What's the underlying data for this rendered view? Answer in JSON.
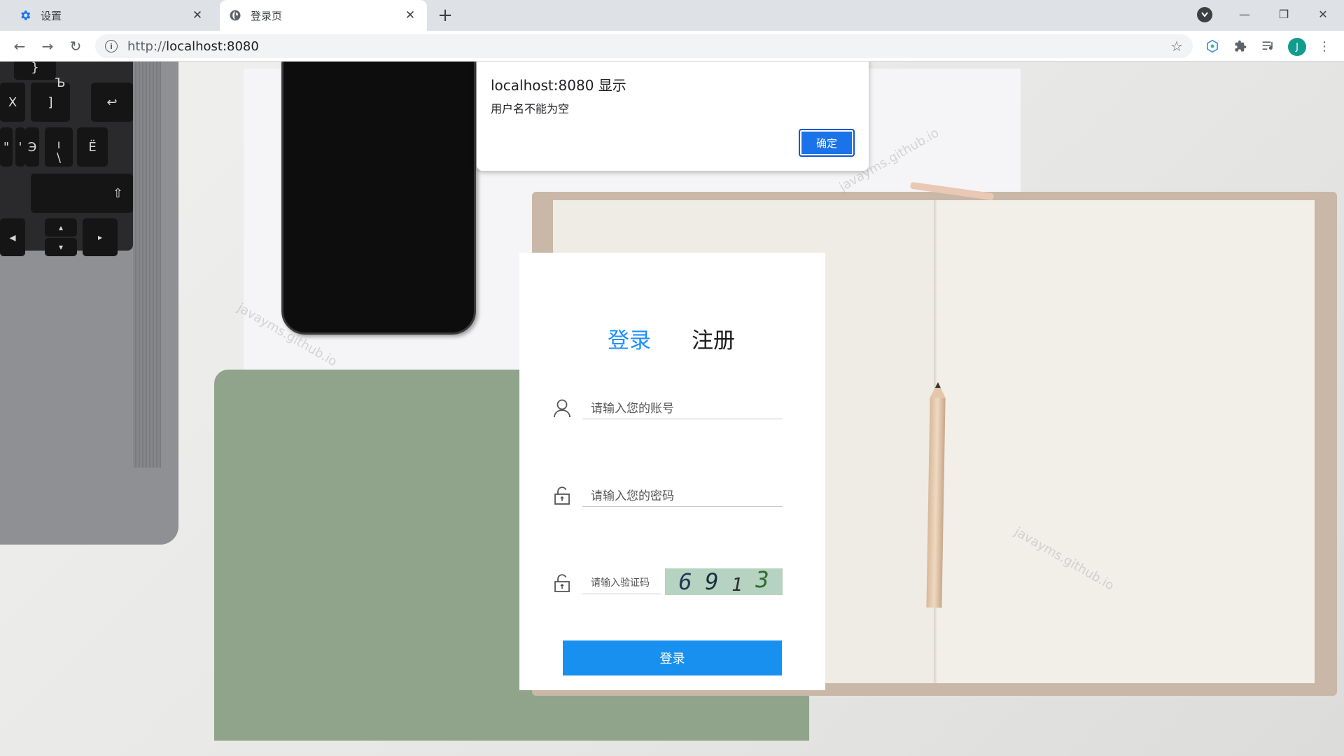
{
  "browser": {
    "tabs": [
      {
        "title": "设置",
        "icon": "gear-icon",
        "active": false
      },
      {
        "title": "登录页",
        "icon": "globe-icon",
        "active": true
      }
    ],
    "url_scheme": "http://",
    "url_host": "localhost:8080",
    "avatar_letter": "J",
    "accent": "#1a73e8"
  },
  "keyboard": {
    "keys": [
      "}",
      "X",
      "]",
      "Ъ",
      "↩",
      "\"",
      "'",
      "Э",
      "|",
      "\\",
      "Ë",
      "⇧",
      "◂",
      "▴",
      "▾",
      "▸"
    ]
  },
  "watermarks": [
    "javayms.github.io",
    "javayms.github.io",
    "javayms.github.io"
  ],
  "login": {
    "tab_login": "登录",
    "tab_register": "注册",
    "username_placeholder": "请输入您的账号",
    "password_placeholder": "请输入您的密码",
    "captcha_placeholder": "请输入验证码",
    "captcha_digits": [
      "6",
      "9",
      "1",
      "3"
    ],
    "submit_label": "登录",
    "accent": "#1890ef"
  },
  "alert": {
    "title": "localhost:8080 显示",
    "message": "用户名不能为空",
    "ok_label": "确定"
  }
}
